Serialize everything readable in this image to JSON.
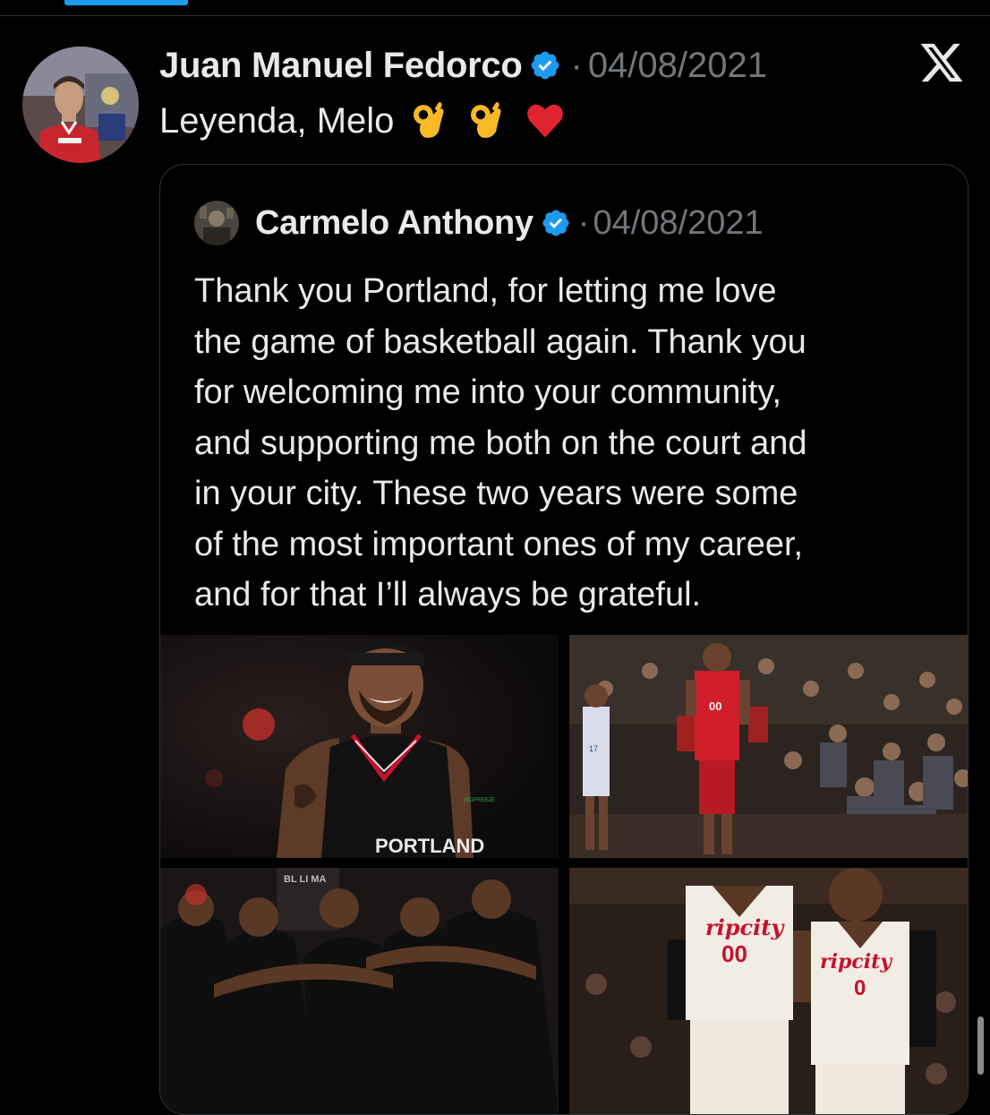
{
  "post": {
    "author_name": "Juan Manuel Fedorco",
    "separator": "·",
    "date": "04/08/2021",
    "text": "Leyenda, Melo",
    "emojis": [
      "ok-hand-emoji",
      "ok-hand-emoji",
      "red-heart-emoji"
    ],
    "verified": true
  },
  "quoted_post": {
    "author_name": "Carmelo Anthony",
    "separator": "·",
    "date": "04/08/2021",
    "verified": true,
    "text_lines": [
      "Thank you Portland, for letting me love",
      "the game of basketball again. Thank you",
      "for welcoming me into your community,",
      "and supporting me both on the court and",
      "in your city. These two years were some",
      "of the most important ones of my career,",
      "and for that I’ll always be grateful."
    ],
    "media": [
      {
        "jersey_text": "PORTLAND",
        "patch_text": "BIOFREEZE"
      },
      {
        "jersey_number": "00",
        "opponent_number": "17"
      },
      {
        "banner_text": "BL LI MA"
      },
      {
        "jersey1_text": "ripcity",
        "jersey1_number": "00",
        "jersey2_text": "ripcity",
        "jersey2_number": "0"
      }
    ]
  },
  "icons": {
    "close": "x-logo-icon",
    "verified": "verified-badge-icon"
  },
  "colors": {
    "background": "#000000",
    "text": "#e7e9ea",
    "muted": "#71767b",
    "accent": "#1d9bf0",
    "border": "#2f3336",
    "heart": "#e0242f"
  }
}
